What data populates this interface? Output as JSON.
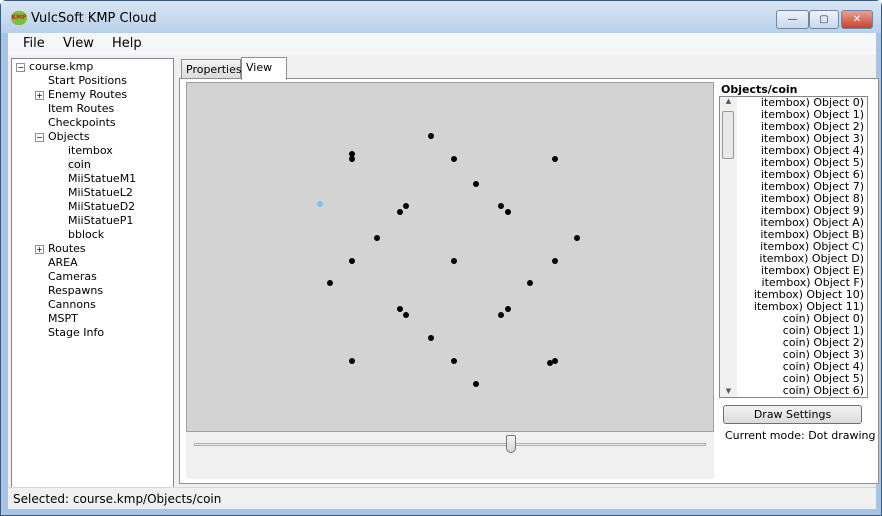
{
  "window": {
    "title": "VulcSoft KMP Cloud",
    "app_icon_text": "KMP",
    "minimize": "—",
    "maximize": "▢",
    "close": "✕"
  },
  "menu": [
    "File",
    "View",
    "Help"
  ],
  "tree": [
    {
      "label": "course.kmp",
      "level": 0,
      "expander": "−"
    },
    {
      "label": "Start Positions",
      "level": 1
    },
    {
      "label": "Enemy Routes",
      "level": 1,
      "expander": "+"
    },
    {
      "label": "Item Routes",
      "level": 1
    },
    {
      "label": "Checkpoints",
      "level": 1
    },
    {
      "label": "Objects",
      "level": 1,
      "expander": "−"
    },
    {
      "label": "itembox",
      "level": 2
    },
    {
      "label": "coin",
      "level": 2,
      "selected": true
    },
    {
      "label": "MiiStatueM1",
      "level": 2
    },
    {
      "label": "MiiStatueL2",
      "level": 2
    },
    {
      "label": "MiiStatueD2",
      "level": 2
    },
    {
      "label": "MiiStatueP1",
      "level": 2
    },
    {
      "label": "bblock",
      "level": 2
    },
    {
      "label": "Routes",
      "level": 1,
      "expander": "+"
    },
    {
      "label": "AREA",
      "level": 1
    },
    {
      "label": "Cameras",
      "level": 1
    },
    {
      "label": "Respawns",
      "level": 1
    },
    {
      "label": "Cannons",
      "level": 1
    },
    {
      "label": "MSPT",
      "level": 1
    },
    {
      "label": "Stage Info",
      "level": 1
    }
  ],
  "tabs": [
    {
      "label": "Properties"
    },
    {
      "label": "View",
      "active": true
    }
  ],
  "objects_title": "Objects/coin",
  "objects_list": [
    "itembox) Object 0)",
    "itembox) Object 1)",
    "itembox) Object 2)",
    "itembox) Object 3)",
    "itembox) Object 4)",
    "itembox) Object 5)",
    "itembox) Object 6)",
    "itembox) Object 7)",
    "itembox) Object 8)",
    "itembox) Object 9)",
    "itembox) Object A)",
    "itembox) Object B)",
    "itembox) Object C)",
    "itembox) Object D)",
    "itembox) Object E)",
    "itembox) Object F)",
    "itembox) Object 10)",
    "itembox) Object 11)",
    "coin) Object 0)",
    "coin) Object 1)",
    "coin) Object 2)",
    "coin) Object 3)",
    "coin) Object 4)",
    "coin) Object 5)",
    "coin) Object 6)"
  ],
  "draw_settings_label": "Draw Settings",
  "current_mode": "Current mode: Dot drawing",
  "zoom_slider_percent": 62,
  "status": "Selected: course.kmp/Objects/coin",
  "colors": {
    "canvas": "#d3d3d3",
    "dot": "#000000",
    "highlight_dot": "#7ec8e3"
  }
}
